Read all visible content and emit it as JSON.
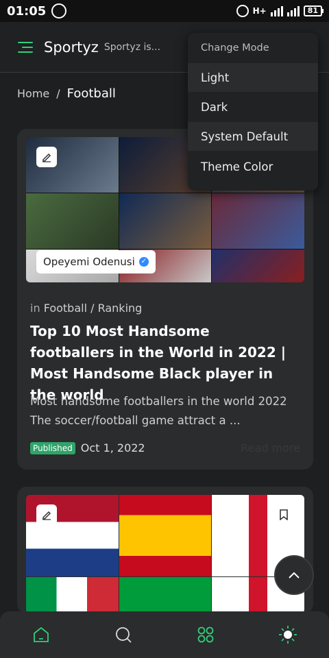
{
  "status_bar": {
    "time": "01:05",
    "battery": "81",
    "network": "H+"
  },
  "app_bar": {
    "title": "Sportyz",
    "subtitle": "Sportyz is..."
  },
  "breadcrumb": {
    "home": "Home",
    "separator": "/",
    "current": "Football"
  },
  "card1": {
    "author": "Opeyemi Odenusi",
    "category_prefix": "in",
    "category": "Football / Ranking",
    "title": "Top 10 Most Handsome footballers in the World in 2022 | Most Handsome Black player in the world",
    "excerpt": "Most handsome footballers in the world 2022 The soccer/football game attract a ...",
    "status": "Published",
    "date": "Oct 1, 2022",
    "read_more": "Read more"
  },
  "dropdown": {
    "header": "Change Mode",
    "options": [
      "Light",
      "Dark",
      "System Default",
      "Theme Color"
    ]
  },
  "bottom_nav": {
    "items": [
      "home-icon",
      "search-icon",
      "categories-icon",
      "theme-icon"
    ]
  },
  "colors": {
    "accent": "#2fd07a",
    "background": "#1d1f20",
    "card": "#2a2c2d",
    "published": "#2fa46a"
  }
}
